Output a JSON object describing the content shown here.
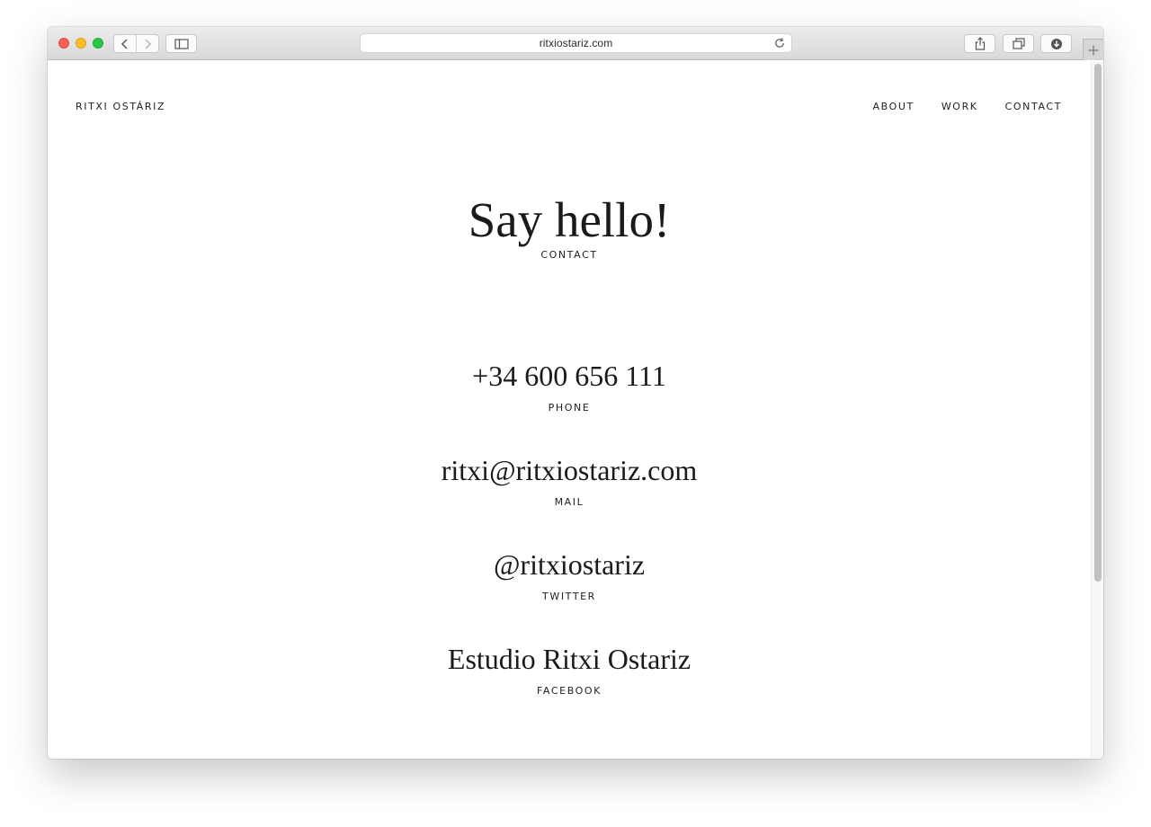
{
  "browser": {
    "url": "ritxiostariz.com",
    "icons": {
      "back": "chevron-left-icon",
      "forward": "chevron-right-icon",
      "sidebar": "sidebar-icon",
      "reload": "reload-icon",
      "share": "share-icon",
      "tabs": "tabs-icon",
      "downloads": "download-icon",
      "new_tab": "plus-icon"
    }
  },
  "site": {
    "name": "RITXI OSTÁRIZ"
  },
  "nav": {
    "items": [
      {
        "label": "ABOUT"
      },
      {
        "label": "WORK"
      },
      {
        "label": "CONTACT"
      }
    ]
  },
  "hero": {
    "title": "Say hello!",
    "subtitle": "CONTACT"
  },
  "contacts": [
    {
      "value": "+34 600 656 111",
      "label": "PHONE"
    },
    {
      "value": "ritxi@ritxiostariz.com",
      "label": "MAIL"
    },
    {
      "value": "@ritxiostariz",
      "label": "TWITTER"
    },
    {
      "value": "Estudio Ritxi Ostariz",
      "label": "FACEBOOK"
    }
  ],
  "colors": {
    "text": "#1a1a1a",
    "background": "#ffffff",
    "traffic_close": "#fc5f57",
    "traffic_minimize": "#fdbc2e",
    "traffic_maximize": "#28c840"
  }
}
